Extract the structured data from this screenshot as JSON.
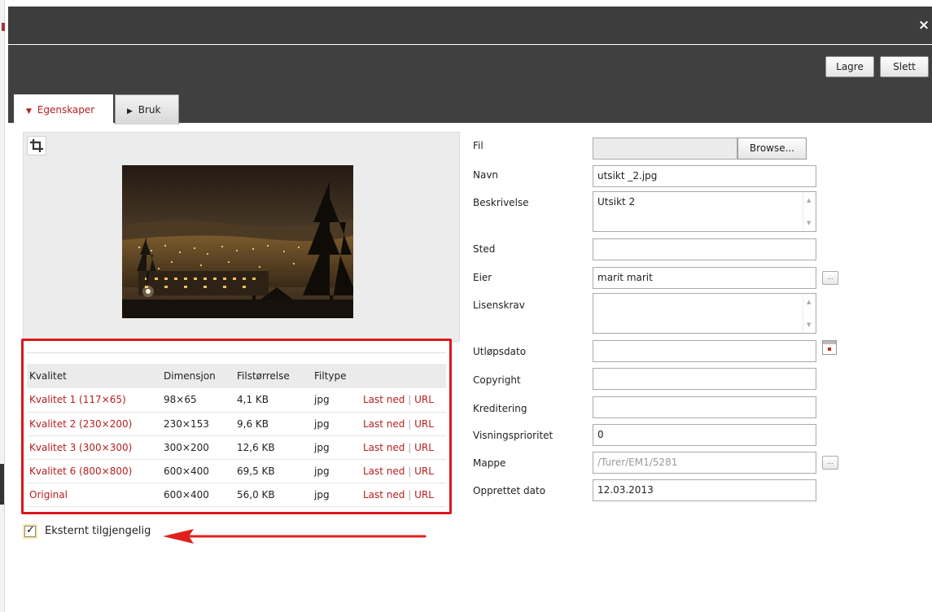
{
  "dialog": {
    "close_icon": "×",
    "buttons": {
      "save": "Lagre",
      "delete": "Slett"
    },
    "tabs": [
      {
        "label": "Egenskaper",
        "arrow": "▼",
        "active": true
      },
      {
        "label": "Bruk",
        "arrow": "▶",
        "active": false
      }
    ]
  },
  "preview": {
    "crop_icon": "crop-icon",
    "image_icon": "night-city-photo"
  },
  "quality_table": {
    "headers": [
      "Kvalitet",
      "Dimensjon",
      "Filstørrelse",
      "Filtype"
    ],
    "download_label": "Last ned",
    "separator": "|",
    "url_label": "URL",
    "rows": [
      {
        "quality": "Kvalitet 1 (117×65)",
        "dimension": "98×65",
        "size": "4,1 KB",
        "type": "jpg"
      },
      {
        "quality": "Kvalitet 2 (230×200)",
        "dimension": "230×153",
        "size": "9,6 KB",
        "type": "jpg"
      },
      {
        "quality": "Kvalitet 3 (300×300)",
        "dimension": "300×200",
        "size": "12,6 KB",
        "type": "jpg"
      },
      {
        "quality": "Kvalitet 6 (800×800)",
        "dimension": "600×400",
        "size": "69,5 KB",
        "type": "jpg"
      },
      {
        "quality": "Original",
        "dimension": "600×400",
        "size": "56,0 KB",
        "type": "jpg"
      }
    ]
  },
  "external": {
    "label": "Eksternt tilgjengelig",
    "checked": true,
    "check_mark": "✓"
  },
  "form": {
    "fil": {
      "label": "Fil",
      "value": "",
      "browse": "Browse..."
    },
    "navn": {
      "label": "Navn",
      "value": "utsikt _2.jpg"
    },
    "beskrivelse": {
      "label": "Beskrivelse",
      "value": "Utsikt 2"
    },
    "sted": {
      "label": "Sted",
      "value": ""
    },
    "eier": {
      "label": "Eier",
      "value": "marit marit",
      "lookup": "..."
    },
    "lisenskrav": {
      "label": "Lisenskrav",
      "value": ""
    },
    "utlopsdato": {
      "label": "Utløpsdato",
      "value": ""
    },
    "copyright": {
      "label": "Copyright",
      "value": ""
    },
    "kreditering": {
      "label": "Kreditering",
      "value": ""
    },
    "visningsprioritet": {
      "label": "Visningsprioritet",
      "value": "0"
    },
    "mappe": {
      "label": "Mappe",
      "value": "/Turer/EM1/5281",
      "lookup": "..."
    },
    "opprettet": {
      "label": "Opprettet dato",
      "value": "12.03.2013"
    }
  },
  "colors": {
    "accent_red": "#b61f1f",
    "highlight_red": "#d9181e",
    "header_dark": "#3d3d3d"
  }
}
